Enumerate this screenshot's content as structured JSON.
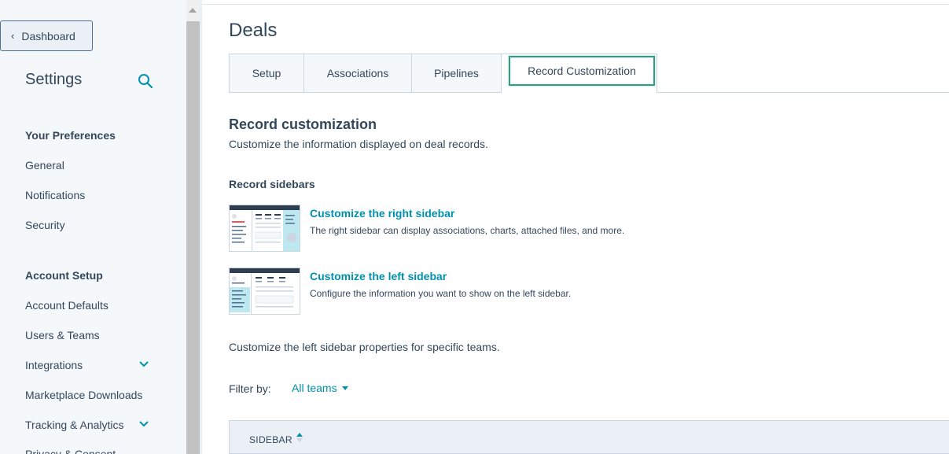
{
  "sidebar": {
    "back_label": "Dashboard",
    "title": "Settings",
    "preferences_heading": "Your Preferences",
    "preferences_items": [
      "General",
      "Notifications",
      "Security"
    ],
    "account_heading": "Account Setup",
    "account_items": [
      "Account Defaults",
      "Users & Teams",
      "Integrations",
      "Marketplace Downloads",
      "Tracking & Analytics",
      "Privacy & Consent"
    ]
  },
  "main": {
    "page_title": "Deals",
    "tabs": [
      {
        "label": "Setup"
      },
      {
        "label": "Associations"
      },
      {
        "label": "Pipelines"
      },
      {
        "label": "Record Customization",
        "active": true
      }
    ],
    "record_customization": {
      "title": "Record customization",
      "subtitle": "Customize the information displayed on deal records."
    },
    "record_sidebars": {
      "title": "Record sidebars",
      "options": [
        {
          "link": "Customize the right sidebar",
          "description": "The right sidebar can display associations, charts, attached files, and more."
        },
        {
          "link": "Customize the left sidebar",
          "description": "Configure the information you want to show on the left sidebar."
        }
      ]
    },
    "teams_note": "Customize the left sidebar properties for specific teams.",
    "filter": {
      "label": "Filter by:",
      "value": "All teams"
    },
    "table": {
      "columns": [
        "SIDEBAR"
      ]
    }
  },
  "colors": {
    "accent": "#0091ae",
    "highlight": "#2fa07f",
    "text": "#33475b",
    "sidebar_bg": "#f5f8fa"
  },
  "icons": {
    "search": "search-icon",
    "back": "chevron-left-icon",
    "expand": "chevron-down-icon"
  }
}
